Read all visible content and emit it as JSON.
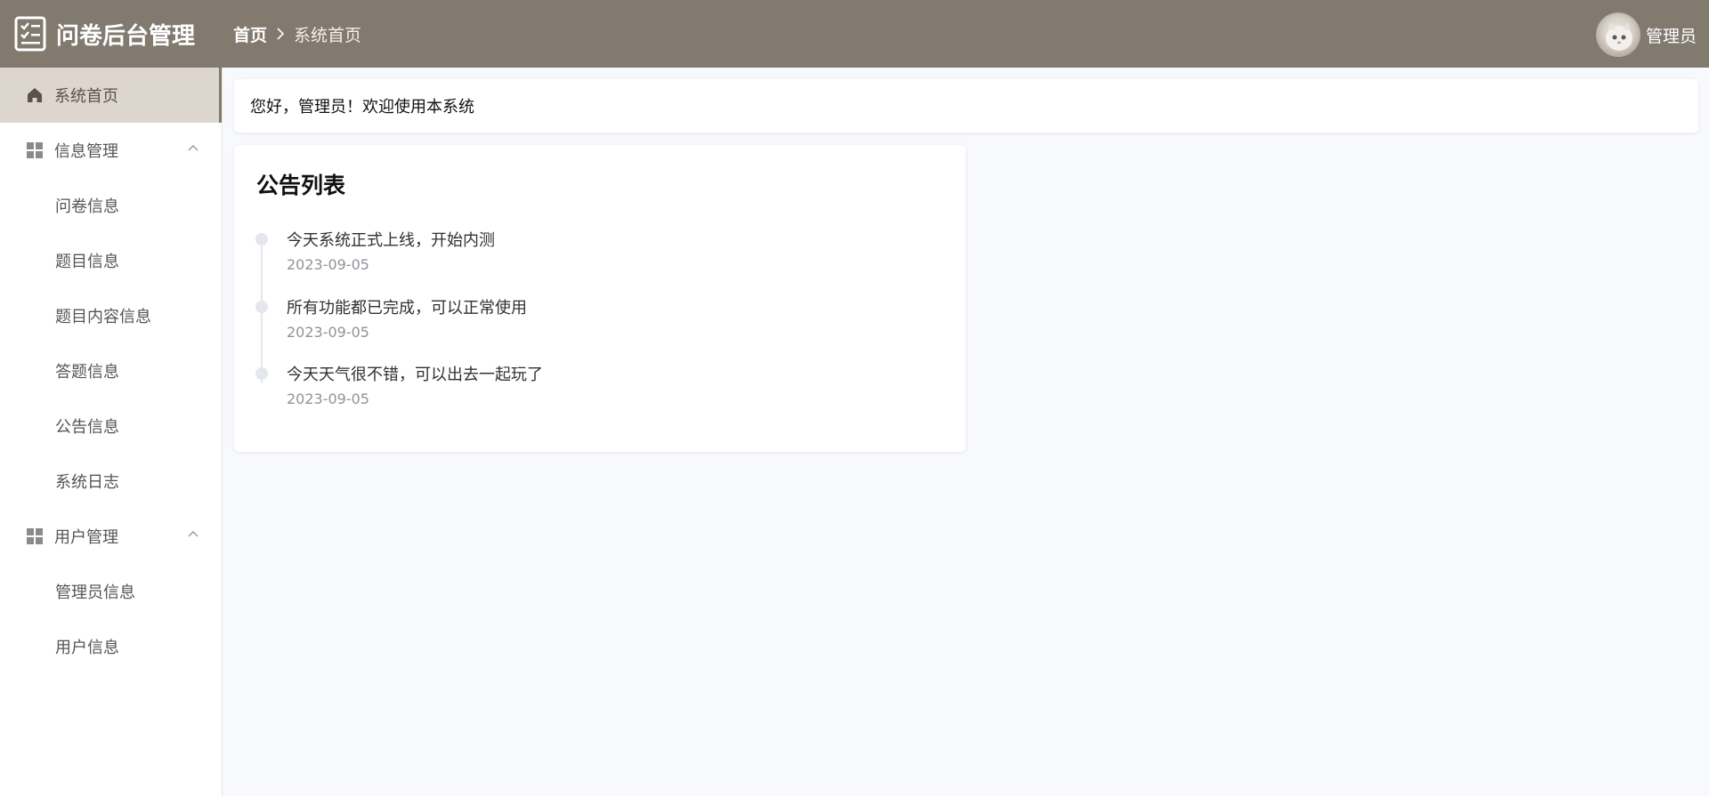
{
  "header": {
    "app_title": "问卷后台管理",
    "breadcrumb": {
      "home": "首页",
      "current": "系统首页"
    },
    "user_name": "管理员",
    "bg_color": "#82796f"
  },
  "sidebar": {
    "items": [
      {
        "label": "系统首页",
        "icon": "home-icon",
        "active": true
      },
      {
        "label": "信息管理",
        "icon": "grid-icon",
        "group": true,
        "expanded": true
      },
      {
        "label": "问卷信息",
        "sub": true
      },
      {
        "label": "题目信息",
        "sub": true
      },
      {
        "label": "题目内容信息",
        "sub": true
      },
      {
        "label": "答题信息",
        "sub": true
      },
      {
        "label": "公告信息",
        "sub": true
      },
      {
        "label": "系统日志",
        "sub": true
      },
      {
        "label": "用户管理",
        "icon": "grid-icon",
        "group": true,
        "expanded": true
      },
      {
        "label": "管理员信息",
        "sub": true
      },
      {
        "label": "用户信息",
        "sub": true
      }
    ]
  },
  "main": {
    "welcome_text": "您好，管理员！欢迎使用本系统",
    "notice": {
      "title": "公告列表",
      "items": [
        {
          "content": "今天系统正式上线，开始内测",
          "date": "2023-09-05"
        },
        {
          "content": "所有功能都已完成，可以正常使用",
          "date": "2023-09-05"
        },
        {
          "content": "今天天气很不错，可以出去一起玩了",
          "date": "2023-09-05"
        }
      ]
    }
  }
}
